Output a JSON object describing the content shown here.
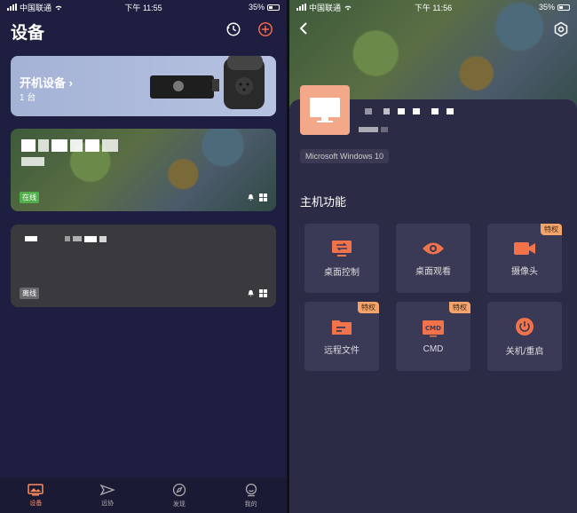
{
  "left": {
    "status": {
      "carrier": "中国联通",
      "time": "下午 11:55",
      "battery": "35%"
    },
    "title": "设备",
    "boot_card": {
      "label": "开机设备",
      "count": "1 台"
    },
    "online_card": {
      "badge": "在线"
    },
    "offline_card": {
      "badge": "离线"
    },
    "tabs": [
      {
        "label": "设备",
        "icon": "device-icon"
      },
      {
        "label": "远协",
        "icon": "remote-assist-icon"
      },
      {
        "label": "发现",
        "icon": "compass-icon"
      },
      {
        "label": "我的",
        "icon": "profile-icon"
      }
    ]
  },
  "right": {
    "status": {
      "carrier": "中国联通",
      "time": "下午 11:56",
      "battery": "35%"
    },
    "os": "Microsoft Windows 10",
    "section_title": "主机功能",
    "privilege_tag": "特权",
    "functions": [
      {
        "label": "桌面控制",
        "icon": "desktop-control-icon",
        "tag": false
      },
      {
        "label": "桌面观看",
        "icon": "eye-icon",
        "tag": false
      },
      {
        "label": "摄像头",
        "icon": "camera-icon",
        "tag": true
      },
      {
        "label": "远程文件",
        "icon": "folder-icon",
        "tag": true
      },
      {
        "label": "CMD",
        "icon": "cmd-icon",
        "tag": true
      },
      {
        "label": "关机/重启",
        "icon": "power-icon",
        "tag": false
      }
    ]
  },
  "colors": {
    "accent": "#ff8c5a",
    "icon": "#f2734a",
    "online": "#52b04a",
    "tag": "#f4a46a"
  }
}
